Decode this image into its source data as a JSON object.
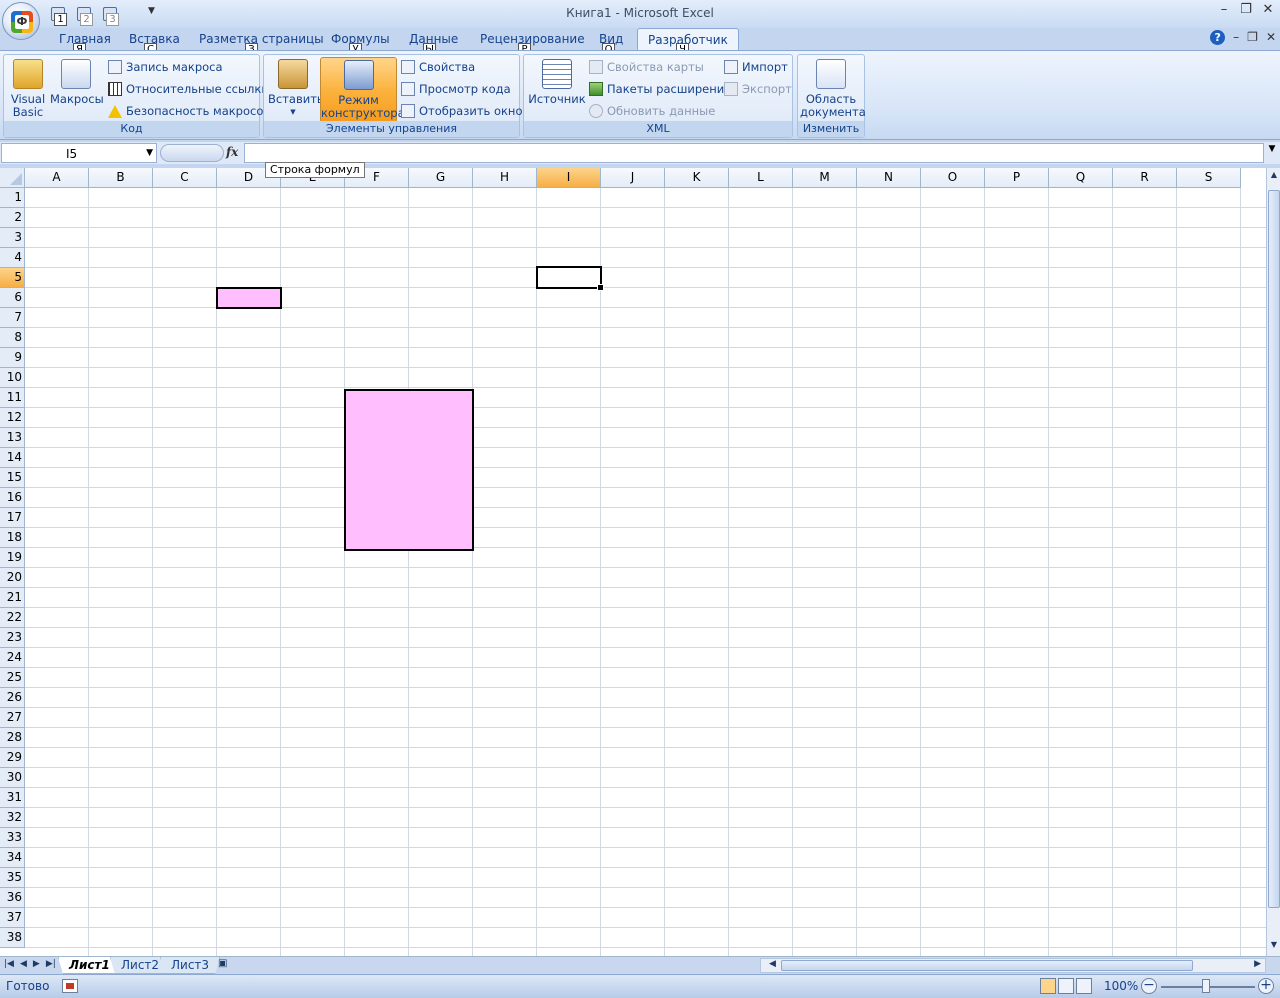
{
  "window": {
    "title": "Книга1 - Microsoft Excel",
    "office_key": "Ф",
    "qat_keytips": [
      "1",
      "2",
      "3"
    ]
  },
  "tabs": [
    {
      "label": "Главная",
      "key": "Я"
    },
    {
      "label": "Вставка",
      "key": "С"
    },
    {
      "label": "Разметка страницы",
      "key": "З"
    },
    {
      "label": "Формулы",
      "key": "У"
    },
    {
      "label": "Данные",
      "key": "Ы"
    },
    {
      "label": "Рецензирование",
      "key": "Р"
    },
    {
      "label": "Вид",
      "key": "О"
    },
    {
      "label": "Разработчик",
      "key": "Ч"
    }
  ],
  "ribbon": {
    "code": {
      "label": "Код",
      "visual_basic": "Visual Basic",
      "macros": "Макросы",
      "record_macro": "Запись макроса",
      "relative_refs": "Относительные ссылки",
      "macro_security": "Безопасность макросов"
    },
    "controls": {
      "label": "Элементы управления",
      "insert": "Вставить",
      "design_mode": "Режим конструктора",
      "properties": "Свойства",
      "view_code": "Просмотр кода",
      "run_dialog": "Отобразить окно"
    },
    "xml": {
      "label": "XML",
      "source": "Источник",
      "map_properties": "Свойства карты",
      "expansion_packs": "Пакеты расширения",
      "refresh_data": "Обновить данные",
      "import": "Импорт",
      "export": "Экспорт"
    },
    "modify": {
      "label": "Изменить",
      "document_panel": "Область документа"
    }
  },
  "formula_bar": {
    "name_box": "I5",
    "fx": "fx",
    "formula": "",
    "tooltip": "Строка формул"
  },
  "grid": {
    "columns": [
      "A",
      "B",
      "C",
      "D",
      "E",
      "F",
      "G",
      "H",
      "I",
      "J",
      "K",
      "L",
      "M",
      "N",
      "O",
      "P",
      "Q",
      "R",
      "S"
    ],
    "rows": 38,
    "selected_col": "I",
    "selected_row": 5
  },
  "sheets": [
    {
      "label": "Лист1",
      "active": true
    },
    {
      "label": "Лист2",
      "active": false
    },
    {
      "label": "Лист3",
      "active": false
    }
  ],
  "status": {
    "ready": "Готово",
    "zoom": "100%"
  },
  "colors": {
    "shape_fill": "#ffbfff",
    "selection_header": "#f7ae45"
  }
}
